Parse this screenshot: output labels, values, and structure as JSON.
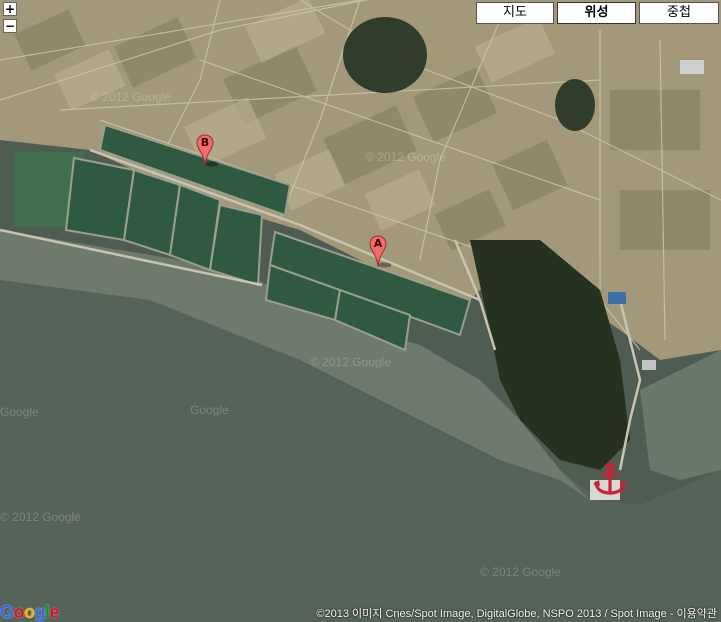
{
  "controls": {
    "zoom_in": "+",
    "zoom_out": "−"
  },
  "map_types": {
    "map": "지도",
    "satellite": "위성",
    "hybrid": "중첩",
    "active": "satellite"
  },
  "markers": [
    {
      "label": "A",
      "color": "#f26b6b"
    },
    {
      "label": "B",
      "color": "#f26b6b"
    }
  ],
  "anchor_icon": {
    "icon": "anchor-icon",
    "color": "#cc1f3a"
  },
  "watermarks": [
    "© 2012 Google",
    "© 2012 Google",
    "© 2012 Google",
    "© 2012 Google",
    "© 2012 Google",
    "Google",
    "Google"
  ],
  "copyright": {
    "text": "©2013 이미지 Cnes/Spot Image, DigitalGlobe, NSPO 2013 / Spot Image - ",
    "terms": "이용약관"
  },
  "logo": {
    "text": "Google",
    "colors": [
      "#3369e8",
      "#d50f25",
      "#eeb211",
      "#3369e8",
      "#009925",
      "#d50f25"
    ]
  }
}
